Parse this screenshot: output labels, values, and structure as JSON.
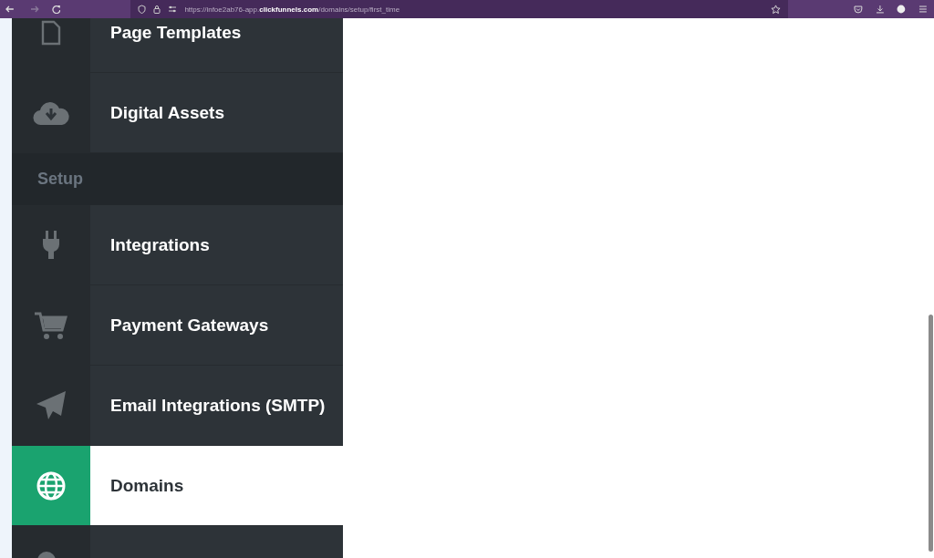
{
  "browser": {
    "url": "https://infoe2ab76-app.**clickfunnels.com**/domains/setup/first_time"
  },
  "sidebar": {
    "sections": [
      {
        "items": [
          {
            "kind": "file",
            "label": "Page Templates",
            "selected": false
          },
          {
            "kind": "cloud",
            "label": "Digital Assets",
            "selected": false
          }
        ]
      },
      {
        "heading": "Setup",
        "items": [
          {
            "kind": "plug",
            "label": "Integrations",
            "selected": false
          },
          {
            "kind": "cart",
            "label": "Payment Gateways",
            "selected": false
          },
          {
            "kind": "send",
            "label": "Email Integrations (SMTP)",
            "selected": false
          },
          {
            "kind": "globe",
            "label": "Domains",
            "selected": true
          },
          {
            "kind": "user",
            "selected": false
          }
        ]
      }
    ]
  }
}
